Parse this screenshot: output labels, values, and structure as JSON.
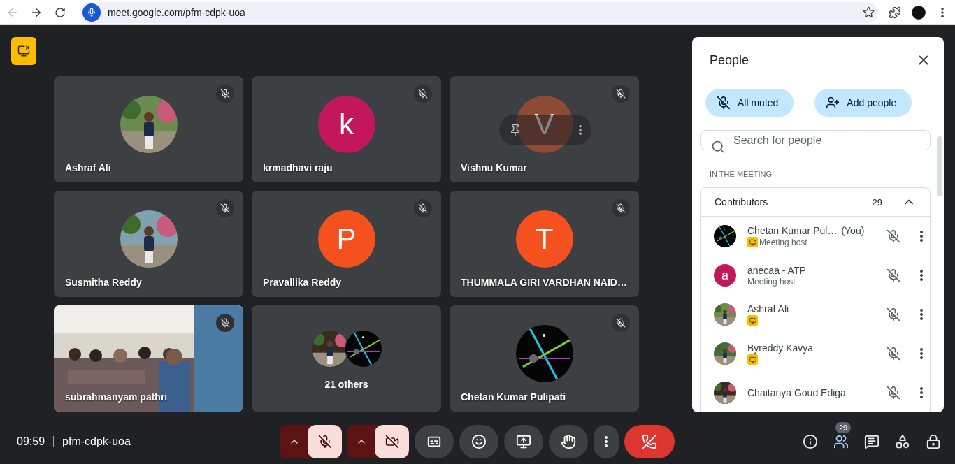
{
  "browser": {
    "url": "meet.google.com/pfm-cdpk-uoa"
  },
  "tiles": [
    {
      "name": "Ashraf Ali",
      "muted": true
    },
    {
      "name": "krmadhavi raju",
      "muted": true,
      "avatar": {
        "kind": "letter",
        "letter": "k",
        "color": "#c2185b"
      }
    },
    {
      "name": "Vishnu Kumar",
      "muted": true,
      "hover_controls": true,
      "avatar": {
        "kind": "letter",
        "letter": "V",
        "color": "#8d4a35"
      }
    },
    {
      "name": "Susmitha Reddy",
      "muted": true
    },
    {
      "name": "Pravallika Reddy",
      "muted": true,
      "avatar": {
        "kind": "letter",
        "letter": "P",
        "color": "#f4511e"
      }
    },
    {
      "name": "THUMMALA GIRI VARDHAN NAID…",
      "muted": true,
      "avatar": {
        "kind": "letter",
        "letter": "T",
        "color": "#f4511e"
      }
    },
    {
      "name": "subrahmanyam pathri",
      "muted": true,
      "avatar": {
        "kind": "video"
      }
    },
    {
      "name": "21 others",
      "muted": false,
      "avatar": {
        "kind": "group"
      }
    },
    {
      "name": "Chetan Kumar Pulipati",
      "muted": true
    }
  ],
  "panel": {
    "title": "People",
    "buttons": [
      {
        "kind": "mute",
        "label": "All muted"
      },
      {
        "kind": "add",
        "label": "Add people"
      }
    ],
    "search": {
      "placeholder": "Search for people"
    },
    "section": "IN THE MEETING",
    "group": {
      "title": "Contributors",
      "count": "29",
      "expanded": true
    },
    "people": [
      {
        "name": "Chetan Kumar Pul…",
        "you": "(You)",
        "role": "Meeting host",
        "badge": true
      },
      {
        "name": "anecaa - ATP",
        "role": "Meeting host",
        "badge": false,
        "avatar": {
          "kind": "letter",
          "letter": "a",
          "color": "#c2185b"
        }
      },
      {
        "name": "Ashraf Ali",
        "badge": true
      },
      {
        "name": "Byreddy Kavya",
        "badge": true
      },
      {
        "name": "Chaitanya Goud Ediga",
        "badge": false
      }
    ]
  },
  "bottom": {
    "time": "09:59",
    "code": "pfm-cdpk-uoa",
    "controls": [
      {
        "kind": "mic",
        "on": false
      },
      {
        "kind": "camera",
        "on": false
      },
      {
        "kind": "captions"
      },
      {
        "kind": "emoji"
      },
      {
        "kind": "present"
      },
      {
        "kind": "hand"
      },
      {
        "kind": "more"
      },
      {
        "kind": "leave"
      }
    ],
    "side": [
      {
        "kind": "info",
        "selected": false
      },
      {
        "kind": "people",
        "selected": true,
        "badge": "29"
      },
      {
        "kind": "chat",
        "selected": false
      },
      {
        "kind": "activities",
        "selected": false
      },
      {
        "kind": "host",
        "selected": false
      }
    ]
  }
}
